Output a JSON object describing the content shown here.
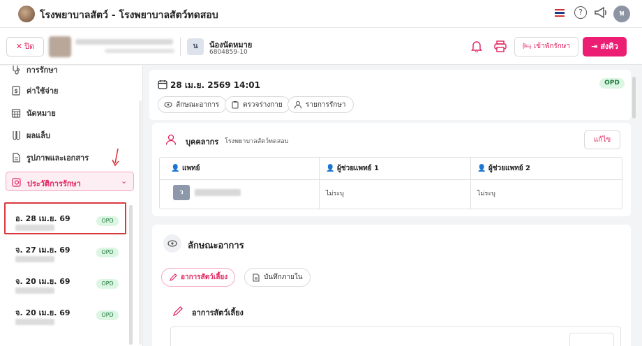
{
  "app": {
    "title": "โรงพยาบาลสัตว์ - โรงพยาบาลสัตว์ทดสอบ",
    "avatar_initial": "พ"
  },
  "patient_bar": {
    "close_label": "ปิด",
    "pet_initial": "น",
    "pet_name": "น้องนัดหมาย",
    "pet_id": "6804859-10",
    "admit_label": "เข้าพักรักษา",
    "queue_label": "ส่งคิว"
  },
  "sidebar": {
    "items": [
      {
        "label": "การรักษา",
        "icon": "stethoscope-icon"
      },
      {
        "label": "ค่าใช้จ่าย",
        "icon": "receipt-icon"
      },
      {
        "label": "นัดหมาย",
        "icon": "calendar-icon"
      },
      {
        "label": "ผลแล็บ",
        "icon": "test-tube-icon"
      },
      {
        "label": "รูปภาพและเอกสาร",
        "icon": "document-icon"
      }
    ],
    "active_item": "ประวัติการรักษา",
    "visits": [
      {
        "date": "อ. 28 เม.ย. 69",
        "badge": "OPD"
      },
      {
        "date": "จ. 27 เม.ย. 69",
        "badge": "OPD"
      },
      {
        "date": "จ. 20 เม.ย. 69",
        "badge": "OPD"
      },
      {
        "date": "จ. 20 เม.ย. 69",
        "badge": "OPD"
      }
    ]
  },
  "visit_header": {
    "datetime": "28 เม.ย. 2569 14:01",
    "badge": "OPD",
    "chips": [
      "ลักษณะอาการ",
      "ตรวจร่างกาย",
      "รายการรักษา"
    ]
  },
  "staff": {
    "title": "บุคคลากร",
    "subtitle": "โรงพยาบาลสัตว์ทดสอบ",
    "edit_label": "แก้ไข",
    "columns": [
      "แพทย์",
      "ผู้ช่วยแพทย์ 1",
      "ผู้ช่วยแพทย์ 2"
    ],
    "doctor_initial": "ว",
    "assistant1": "ไม่ระบุ",
    "assistant2": "ไม่ระบุ"
  },
  "symptoms": {
    "title": "ลักษณะอาการ",
    "tabs": [
      "อาการสัตว์เลี้ยง",
      "บันทึกภายใน"
    ],
    "section_title": "อาการสัตว์เลี้ยง"
  },
  "colors": {
    "accent": "#ec1e73",
    "opd_bg": "#dcf6e3",
    "opd_text": "#1f7a3d",
    "highlight": "#d9383e"
  }
}
